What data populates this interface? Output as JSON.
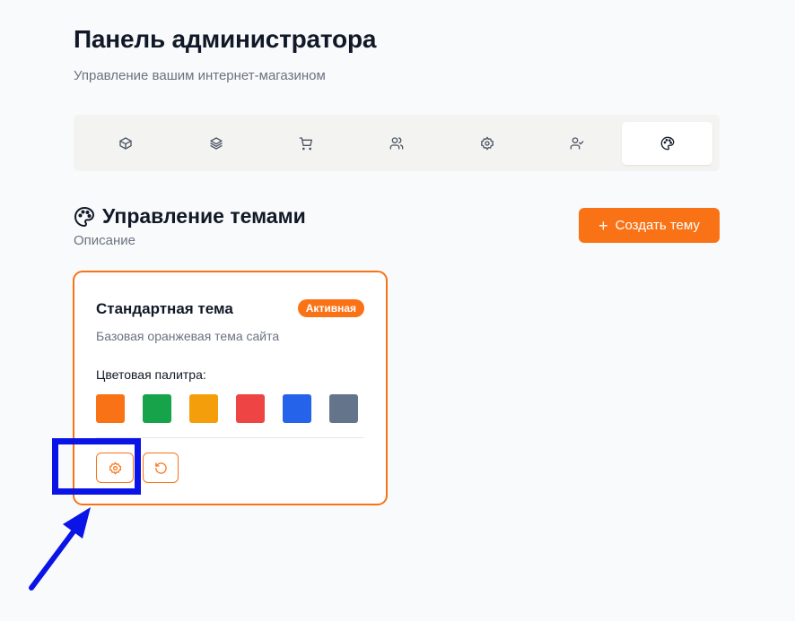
{
  "header": {
    "title": "Панель администратора",
    "subtitle": "Управление вашим интернет-магазином"
  },
  "tabs": [
    {
      "icon": "package-icon",
      "active": false
    },
    {
      "icon": "layers-icon",
      "active": false
    },
    {
      "icon": "shopping-cart-icon",
      "active": false
    },
    {
      "icon": "users-icon",
      "active": false
    },
    {
      "icon": "settings-icon",
      "active": false
    },
    {
      "icon": "user-check-icon",
      "active": false
    },
    {
      "icon": "palette-icon",
      "active": true
    }
  ],
  "section": {
    "title": "Управление темами",
    "description": "Описание",
    "create_button": "Создать тему"
  },
  "theme_card": {
    "title": "Стандартная тема",
    "badge": "Активная",
    "description": "Базовая оранжевая тема сайта",
    "palette_label": "Цветовая палитра:",
    "swatches": [
      "#f97316",
      "#16a34a",
      "#f59e0b",
      "#ef4444",
      "#2563eb",
      "#64748b"
    ]
  },
  "colors": {
    "accent": "#f97316",
    "annotation": "#0a14e6"
  }
}
